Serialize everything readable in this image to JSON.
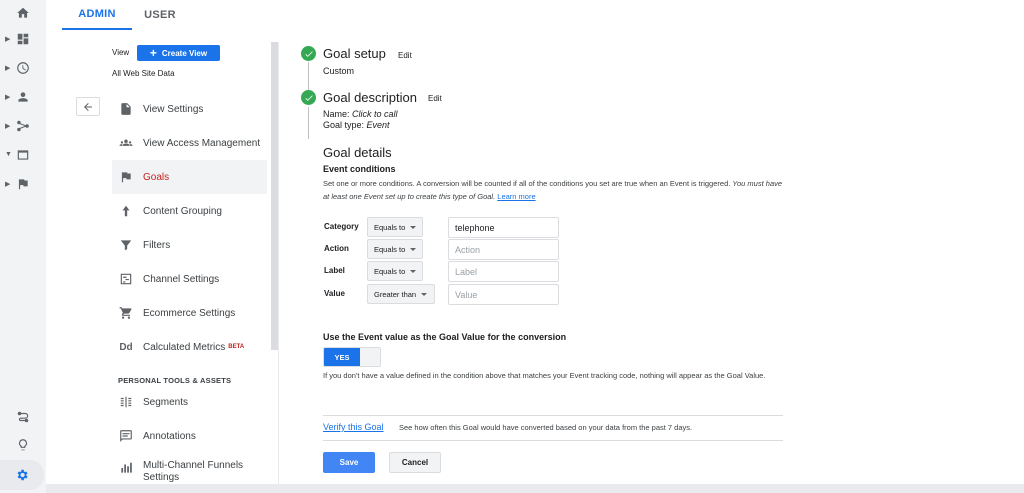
{
  "tabs": {
    "admin": "ADMIN",
    "user": "USER"
  },
  "view": {
    "label": "View",
    "create_button": "Create View",
    "name": "All Web Site Data"
  },
  "menu": {
    "items": [
      {
        "label": "View Settings",
        "icon": "document-icon"
      },
      {
        "label": "View Access Management",
        "icon": "people-icon"
      },
      {
        "label": "Goals",
        "icon": "flag-icon"
      },
      {
        "label": "Content Grouping",
        "icon": "walker-icon"
      },
      {
        "label": "Filters",
        "icon": "filter-icon"
      },
      {
        "label": "Channel Settings",
        "icon": "channel-icon"
      },
      {
        "label": "Ecommerce Settings",
        "icon": "cart-icon"
      },
      {
        "label": "Calculated Metrics",
        "icon": "dd-icon",
        "badge": "BETA"
      }
    ],
    "section_title": "PERSONAL TOOLS & ASSETS",
    "personal_items": [
      {
        "label": "Segments",
        "icon": "segments-icon"
      },
      {
        "label": "Annotations",
        "icon": "annotation-icon"
      },
      {
        "label": "Multi-Channel Funnels Settings",
        "icon": "bar-chart-icon"
      }
    ]
  },
  "goal": {
    "setup": {
      "title": "Goal setup",
      "edit": "Edit",
      "value": "Custom"
    },
    "description": {
      "title": "Goal description",
      "edit": "Edit",
      "name_label": "Name:",
      "name_value": "Click to call",
      "type_label": "Goal type:",
      "type_value": "Event"
    },
    "details": {
      "title": "Goal details",
      "conditions_title": "Event conditions",
      "conditions_desc": "Set one or more conditions. A conversion will be counted if all of the conditions you set are true when an Event is triggered.",
      "conditions_desc_italic": "You must have at least one Event set up to create this type of Goal.",
      "learn_more": "Learn more",
      "conditions": [
        {
          "label": "Category",
          "operator": "Equals to",
          "value": "telephone",
          "placeholder": "Category"
        },
        {
          "label": "Action",
          "operator": "Equals to",
          "value": "",
          "placeholder": "Action"
        },
        {
          "label": "Label",
          "operator": "Equals to",
          "value": "",
          "placeholder": "Label"
        },
        {
          "label": "Value",
          "operator": "Greater than",
          "value": "",
          "placeholder": "Value"
        }
      ],
      "value_title": "Use the Event value as the Goal Value for the conversion",
      "toggle_label": "YES",
      "value_desc": "If you don't have a value defined in the condition above that matches your Event tracking code, nothing will appear as the Goal Value."
    },
    "verify": {
      "link": "Verify this Goal",
      "desc": "See how often this Goal would have converted based on your data from the past 7 days."
    },
    "save": "Save",
    "cancel": "Cancel"
  },
  "colors": {
    "accent": "#1a73e8",
    "success": "#34a853",
    "active_menu": "#c5221f"
  }
}
